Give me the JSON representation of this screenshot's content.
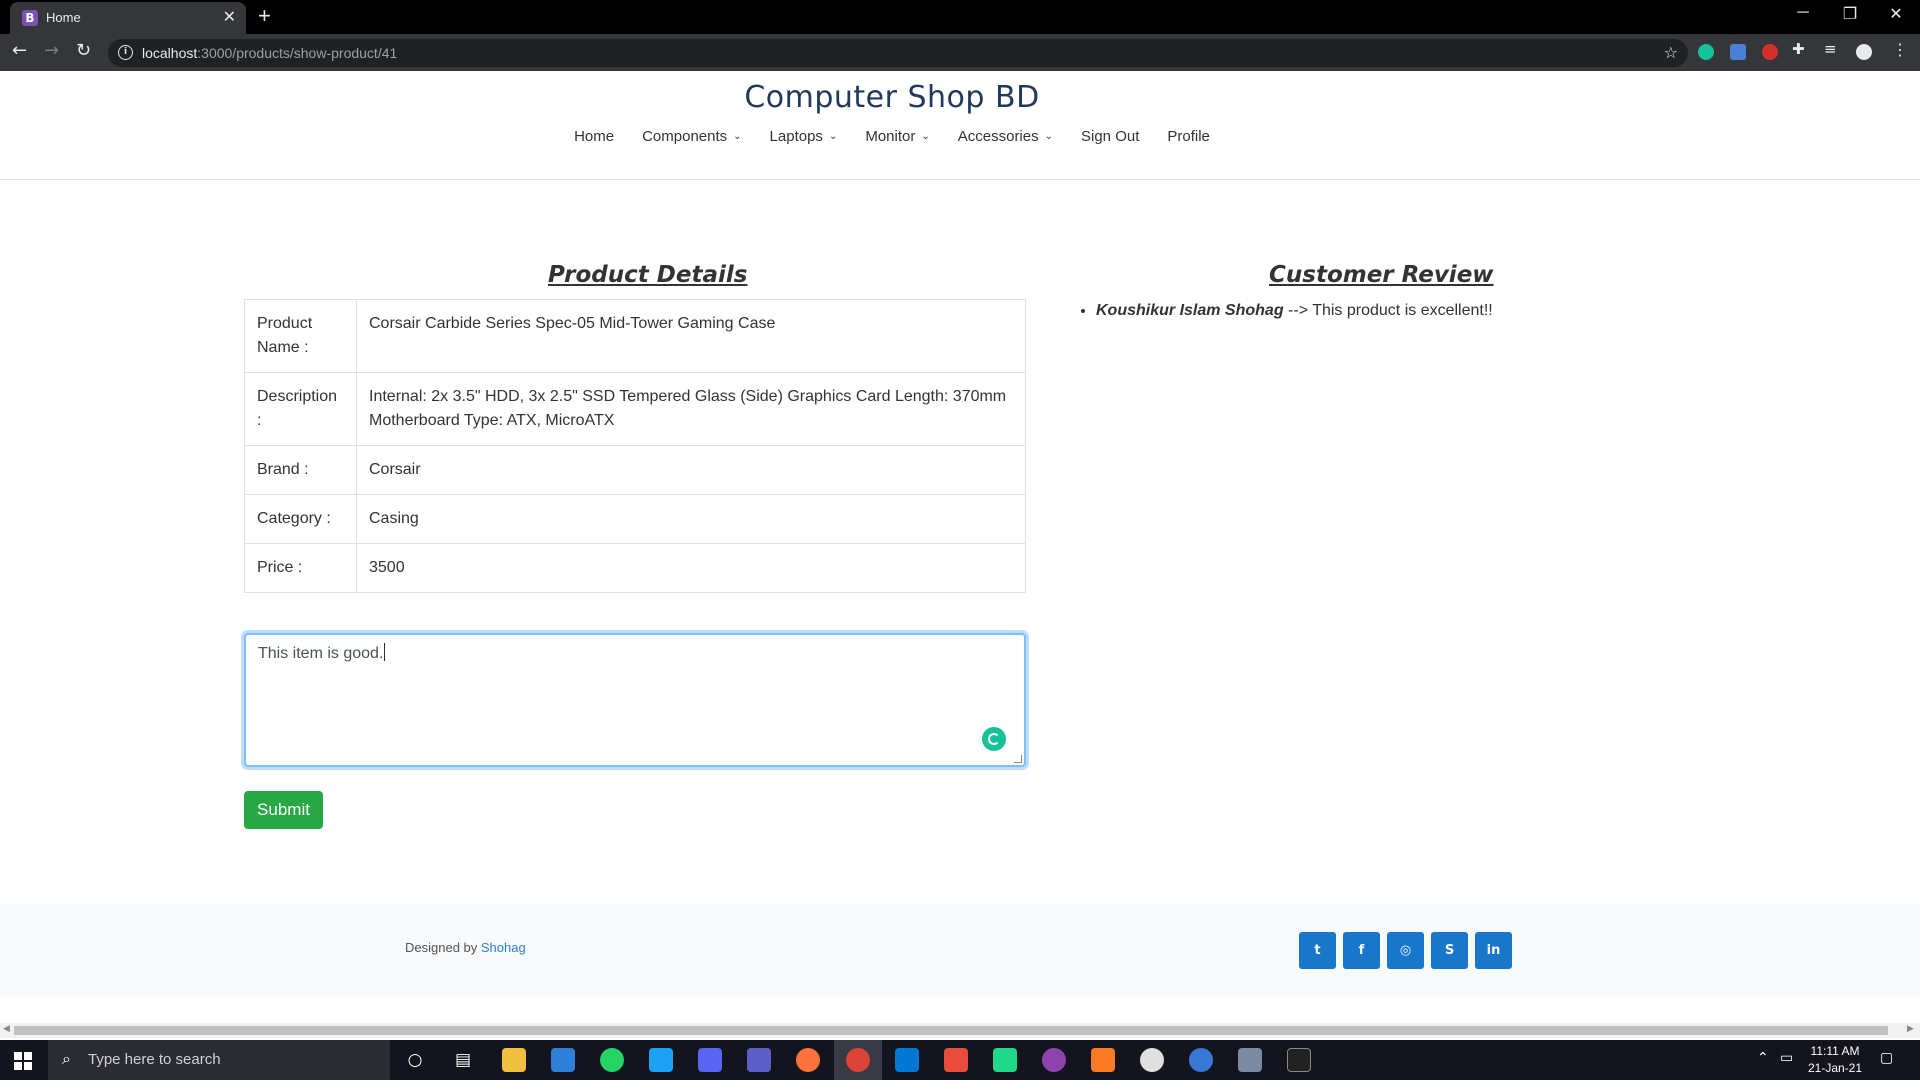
{
  "browser": {
    "tab_title": "Home",
    "tab_favicon": "B",
    "tab_close": "✕",
    "new_tab": "+",
    "url_host": "localhost",
    "url_rest": ":3000/products/show-product/41",
    "window_controls": {
      "minimize": "─",
      "restore": "❐",
      "close": "✕"
    }
  },
  "header": {
    "brand": "Computer Shop BD",
    "nav": [
      {
        "label": "Home",
        "dropdown": false
      },
      {
        "label": "Components",
        "dropdown": true
      },
      {
        "label": "Laptops",
        "dropdown": true
      },
      {
        "label": "Monitor",
        "dropdown": true
      },
      {
        "label": "Accessories",
        "dropdown": true
      },
      {
        "label": "Sign Out",
        "dropdown": false
      },
      {
        "label": "Profile",
        "dropdown": false
      }
    ]
  },
  "product": {
    "title": "Product Details",
    "rows": [
      {
        "key": "Product Name :",
        "value": "Corsair Carbide Series Spec-05 Mid-Tower Gaming Case"
      },
      {
        "key": "Description :",
        "value": "Internal: 2x 3.5\" HDD, 3x 2.5\" SSD Tempered Glass (Side) Graphics Card Length: 370mm Motherboard Type: ATX, MicroATX"
      },
      {
        "key": "Brand :",
        "value": "Corsair"
      },
      {
        "key": "Category :",
        "value": "Casing"
      },
      {
        "key": "Price :",
        "value": "3500"
      }
    ]
  },
  "review": {
    "title": "Customer Review",
    "items": [
      {
        "author": "Koushikur Islam Shohag",
        "separator": " --> ",
        "text": "This product is excellent!!"
      }
    ]
  },
  "comment_form": {
    "value": "This item is good.",
    "submit_label": "Submit"
  },
  "footer": {
    "credit_prefix": "Designed by ",
    "credit_link": "Shohag",
    "social": [
      {
        "icon": "twitter-icon",
        "glyph": "t"
      },
      {
        "icon": "facebook-icon",
        "glyph": "f"
      },
      {
        "icon": "instagram-icon",
        "glyph": "◎"
      },
      {
        "icon": "skype-icon",
        "glyph": "S"
      },
      {
        "icon": "linkedin-icon",
        "glyph": "in"
      }
    ]
  },
  "taskbar": {
    "search_placeholder": "Type here to search",
    "time": "11:11 AM",
    "date": "21-Jan-21"
  }
}
